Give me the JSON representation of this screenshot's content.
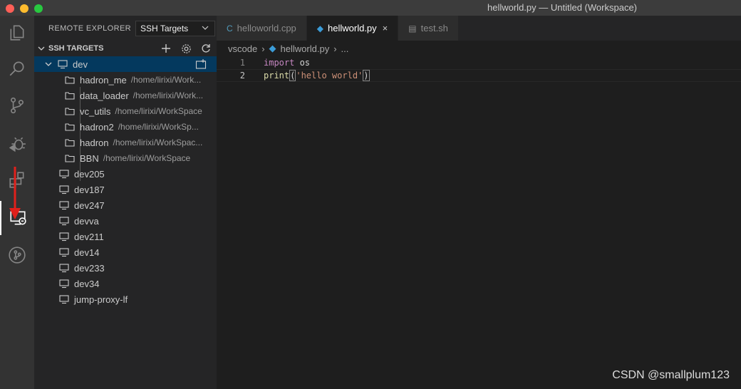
{
  "window": {
    "title": "hellworld.py — Untitled (Workspace)"
  },
  "sidebar": {
    "title": "REMOTE EXPLORER",
    "select_value": "SSH Targets",
    "section_title": "SSH TARGETS",
    "hosts": [
      {
        "name": "dev",
        "expanded": true,
        "folders": [
          {
            "name": "hadron_me",
            "path": "/home/lirixi/Work..."
          },
          {
            "name": "data_loader",
            "path": "/home/lirixi/Work..."
          },
          {
            "name": "vc_utils",
            "path": "/home/lirixi/WorkSpace"
          },
          {
            "name": "hadron2",
            "path": "/home/lirixi/WorkSp..."
          },
          {
            "name": "hadron",
            "path": "/home/lirixi/WorkSpac..."
          },
          {
            "name": "BBN",
            "path": "/home/lirixi/WorkSpace"
          }
        ]
      },
      {
        "name": "dev205"
      },
      {
        "name": "dev187"
      },
      {
        "name": "dev247"
      },
      {
        "name": "devva"
      },
      {
        "name": "dev211"
      },
      {
        "name": "dev14"
      },
      {
        "name": "dev233"
      },
      {
        "name": "dev34"
      },
      {
        "name": "jump-proxy-lf"
      }
    ]
  },
  "editor": {
    "tabs": [
      {
        "label": "helloworld.cpp",
        "icon": "cpp-file-icon",
        "active": false
      },
      {
        "label": "hellworld.py",
        "icon": "python-file-icon",
        "active": true,
        "close": "×"
      },
      {
        "label": "test.sh",
        "icon": "shell-file-icon",
        "active": false
      }
    ],
    "breadcrumb": [
      "vscode",
      "hellworld.py",
      "..."
    ],
    "lines": [
      {
        "num": "1",
        "kw": "import",
        "rest": " os"
      },
      {
        "num": "2",
        "fn": "print",
        "open": "(",
        "str": "'hello world'",
        "close": ")"
      }
    ]
  },
  "watermark": "CSDN @smallplum123",
  "colors": {
    "accent": "#04395e",
    "arrow": "#e0201b"
  }
}
